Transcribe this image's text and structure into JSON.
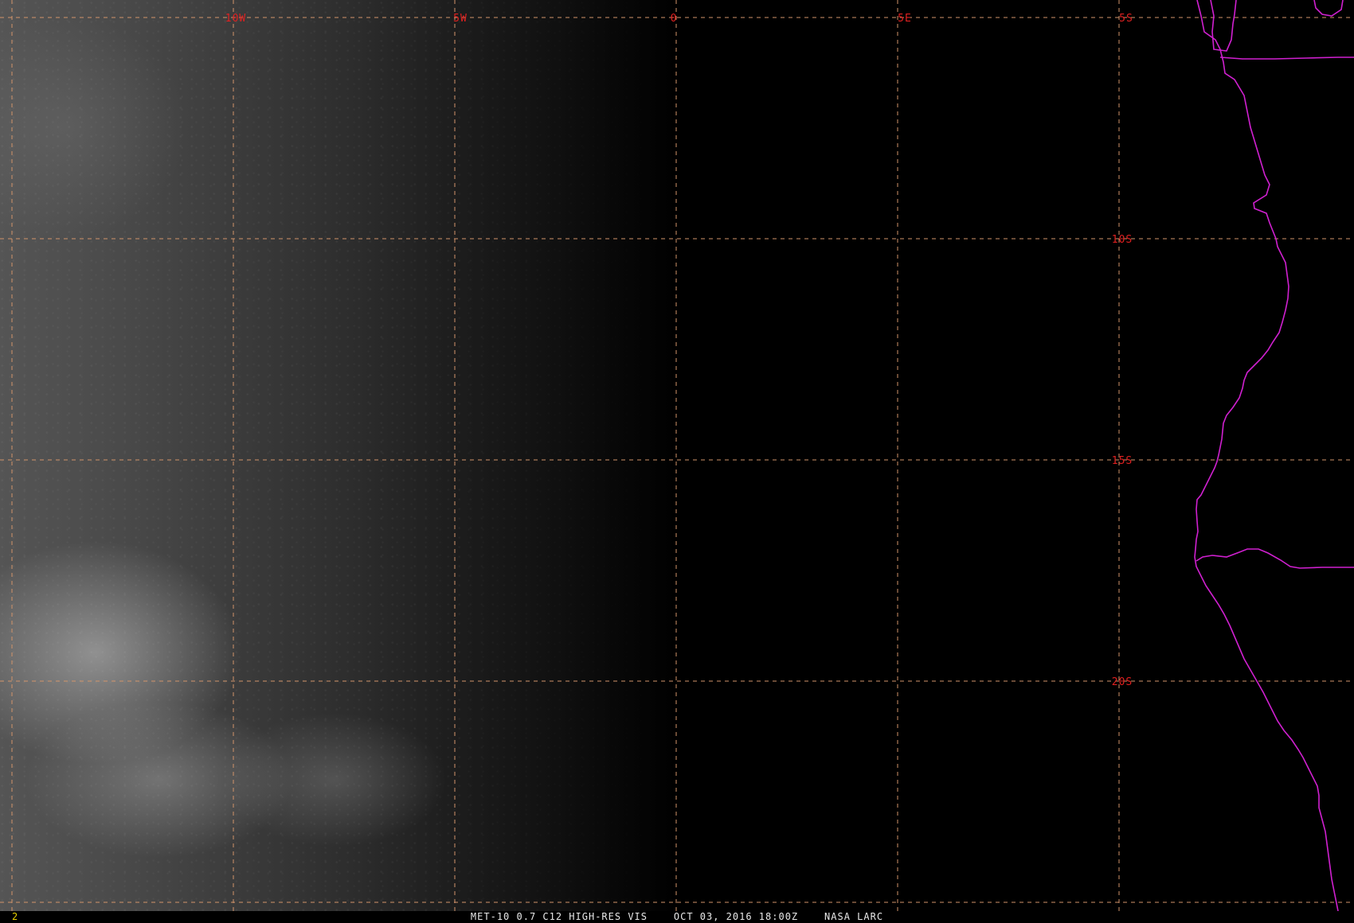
{
  "map": {
    "longitude_labels": [
      "10W",
      "5W",
      "0",
      "5E"
    ],
    "latitude_labels": [
      "5S",
      "10S",
      "15S",
      "20S"
    ],
    "grid_color": "#d2946a",
    "label_color": "#e02020",
    "boundary_color": "#d020d0"
  },
  "status_bar": {
    "frame_number": "2",
    "caption": "MET-10 0.7 C12 HIGH-RES VIS    OCT 03, 2016 18:00Z    NASA LARC"
  }
}
